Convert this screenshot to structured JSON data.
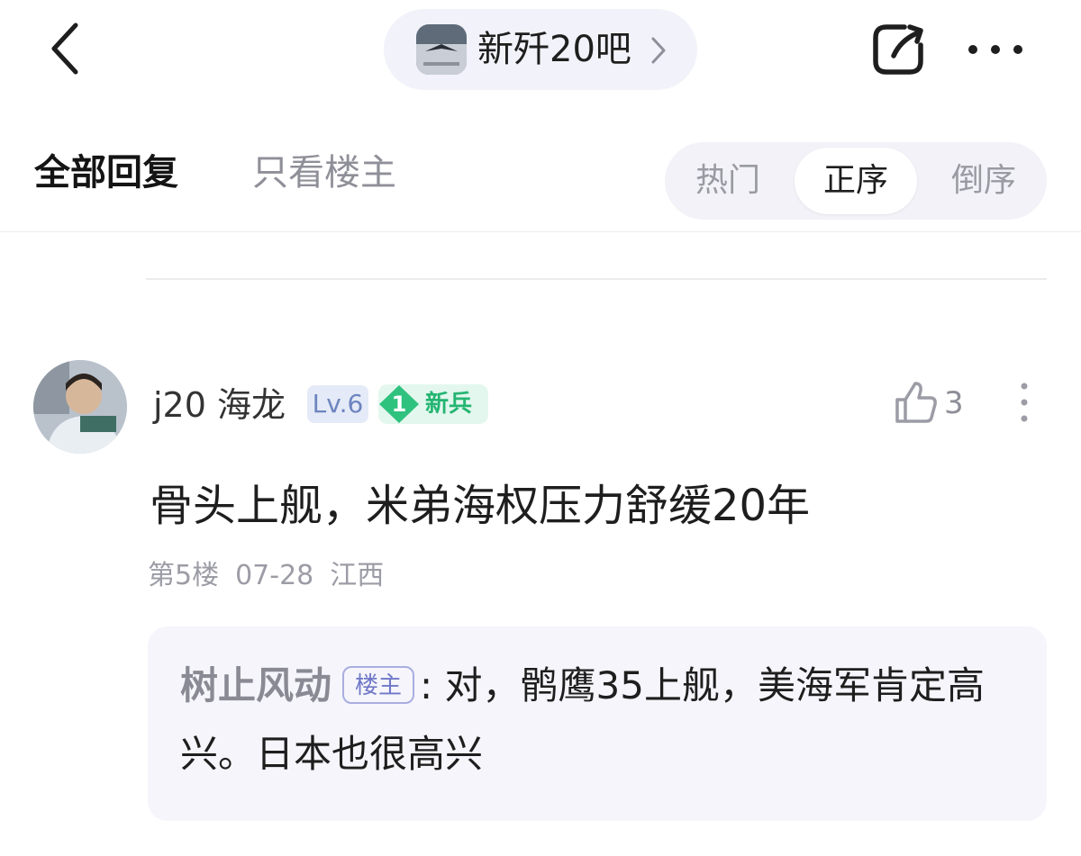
{
  "header": {
    "forum_name": "新歼20吧",
    "icons": {
      "back": "chevron-left-icon",
      "forum_chevron": "chevron-right-icon",
      "share": "share-icon",
      "more": "more-horizontal-icon"
    }
  },
  "tabs": {
    "all_replies": "全部回复",
    "owner_only": "只看楼主"
  },
  "sort": {
    "options": [
      "热门",
      "正序",
      "倒序"
    ],
    "selected": "正序"
  },
  "post": {
    "username": "j20 海龙",
    "level": "Lv.6",
    "rank_number": "1",
    "rank_label": "新兵",
    "like_count": "3",
    "content": "骨头上舰，米弟海权压力舒缓20年",
    "floor": "第5楼",
    "date": "07-28",
    "location": "江西",
    "reply": {
      "author": "树止风动",
      "owner_tag": "楼主",
      "separator": ":",
      "text": " 对，鹘鹰35上舰，美海军肯定高兴。日本也很高兴"
    }
  },
  "colors": {
    "accent_green": "#24b572",
    "level_blue": "#6d84bf",
    "owner_tag_purple": "#7078c8",
    "pill_background": "#f2f2fa"
  }
}
